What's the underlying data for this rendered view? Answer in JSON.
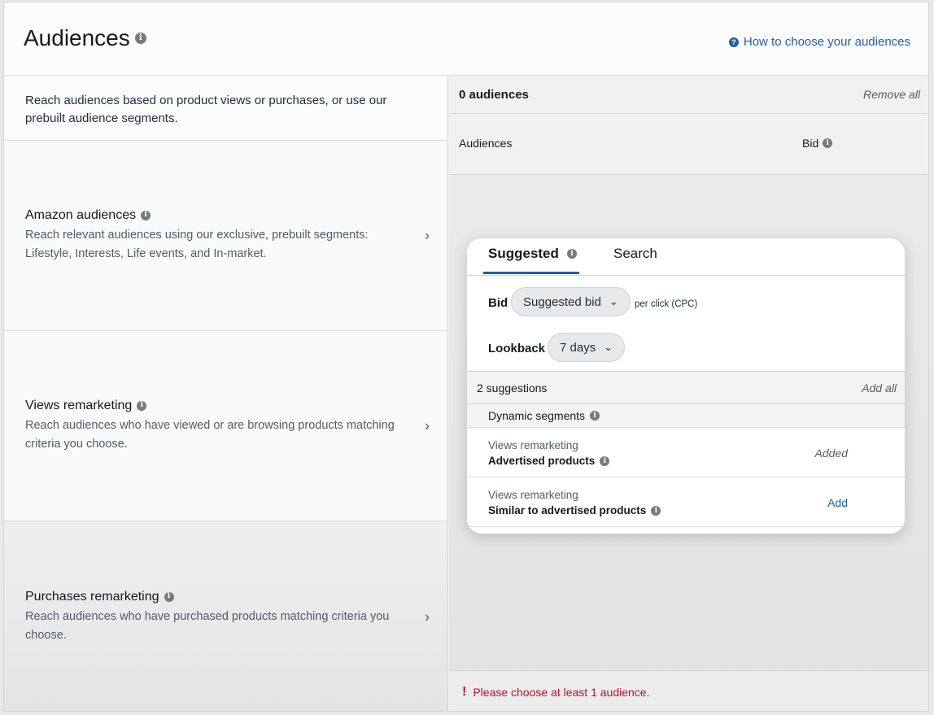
{
  "header": {
    "title": "Audiences",
    "help_link": "How to choose your audiences"
  },
  "left": {
    "intro": "Reach audiences based on product views or purchases, or use our prebuilt audience segments.",
    "options": [
      {
        "title": "Amazon audiences",
        "desc": "Reach relevant audiences using our exclusive, prebuilt segments: Lifestyle, Interests, Life events, and In-market."
      },
      {
        "title": "Views remarketing",
        "desc": "Reach audiences who have viewed or are browsing products matching criteria you choose."
      },
      {
        "title": "Purchases remarketing",
        "desc": "Reach audiences who have purchased products matching criteria you choose."
      }
    ]
  },
  "right": {
    "count": "0 audiences",
    "remove_all": "Remove all",
    "col_audiences": "Audiences",
    "col_bid": "Bid",
    "error": "Please choose at least 1 audience."
  },
  "card": {
    "tabs": [
      "Suggested",
      "Search"
    ],
    "bid_label": "Bid",
    "bid_value": "Suggested bid",
    "bid_note": "per click (CPC)",
    "lookback_label": "Lookback",
    "lookback_value": "7 days",
    "suggestions_count": "2 suggestions",
    "add_all": "Add all",
    "group_title": "Dynamic segments",
    "items": [
      {
        "type": "Views remarketing",
        "name": "Advertised products",
        "status": "Added"
      },
      {
        "type": "Views remarketing",
        "name": "Similar to advertised products",
        "action": "Add"
      }
    ]
  }
}
